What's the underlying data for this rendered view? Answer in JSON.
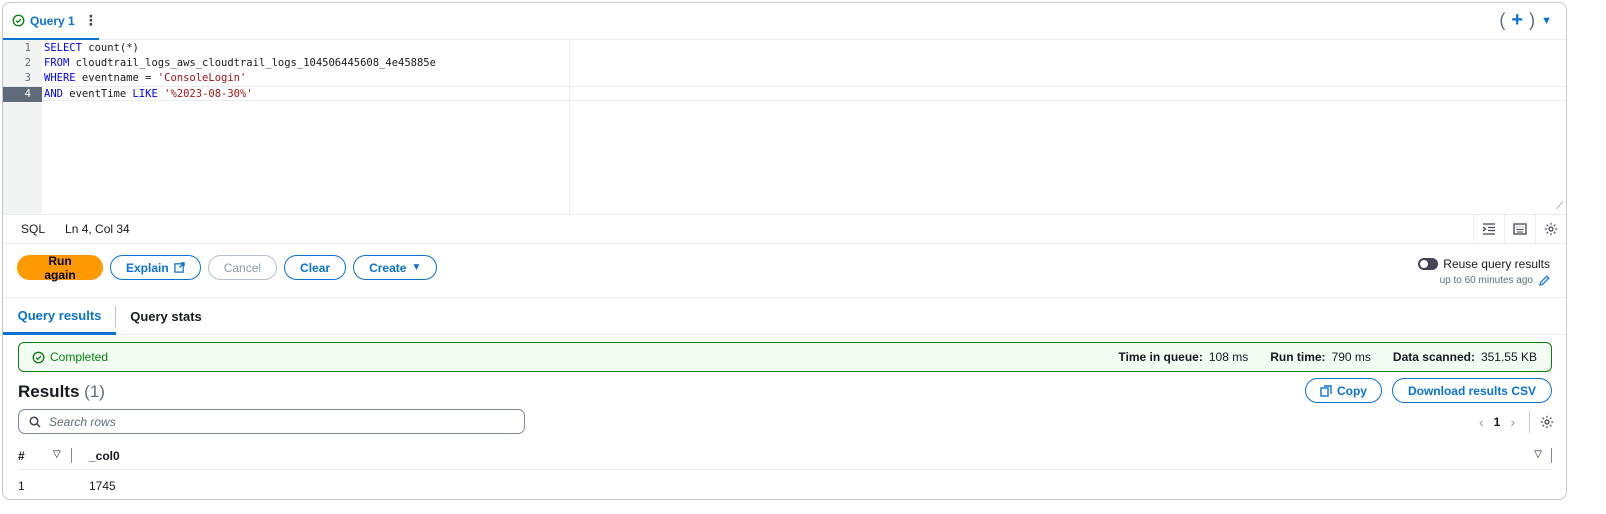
{
  "tab": {
    "label": "Query 1"
  },
  "editor": {
    "lines": [
      {
        "num": "1",
        "parts": [
          {
            "t": "SELECT",
            "c": "kw"
          },
          {
            "t": " count(*)",
            "c": ""
          }
        ]
      },
      {
        "num": "2",
        "parts": [
          {
            "t": "FROM",
            "c": "kw"
          },
          {
            "t": " cloudtrail_logs_aws_cloudtrail_logs_104506445608_4e45885e",
            "c": ""
          }
        ]
      },
      {
        "num": "3",
        "parts": [
          {
            "t": "WHERE",
            "c": "kw"
          },
          {
            "t": " eventname = ",
            "c": ""
          },
          {
            "t": "'ConsoleLogin'",
            "c": "str"
          }
        ]
      },
      {
        "num": "4",
        "parts": [
          {
            "t": "AND",
            "c": "kw"
          },
          {
            "t": " eventTime ",
            "c": ""
          },
          {
            "t": "LIKE",
            "c": "kw"
          },
          {
            "t": " ",
            "c": ""
          },
          {
            "t": "'%2023-08-30%'",
            "c": "str"
          }
        ]
      }
    ],
    "active_line": 4
  },
  "status": {
    "language": "SQL",
    "cursor": "Ln 4, Col 34"
  },
  "toolbar": {
    "run_again": "Run again",
    "explain": "Explain",
    "cancel": "Cancel",
    "clear": "Clear",
    "create": "Create"
  },
  "reuse": {
    "label": "Reuse query results",
    "sub": "up to 60 minutes ago",
    "enabled": false
  },
  "result_tabs": {
    "results": "Query results",
    "stats": "Query stats"
  },
  "banner": {
    "status": "Completed",
    "queue_label": "Time in queue:",
    "queue_value": "108 ms",
    "run_label": "Run time:",
    "run_value": "790 ms",
    "scanned_label": "Data scanned:",
    "scanned_value": "351.55 KB"
  },
  "results": {
    "title": "Results",
    "count": "(1)",
    "copy": "Copy",
    "download": "Download results CSV",
    "search_placeholder": "Search rows",
    "page": "1",
    "columns": {
      "index": "#",
      "col0": "_col0"
    },
    "rows": [
      {
        "index": "1",
        "col0": "1745"
      }
    ]
  },
  "colors": {
    "accent": "#0972d3",
    "primary": "#ff9900",
    "success": "#037f0c"
  }
}
